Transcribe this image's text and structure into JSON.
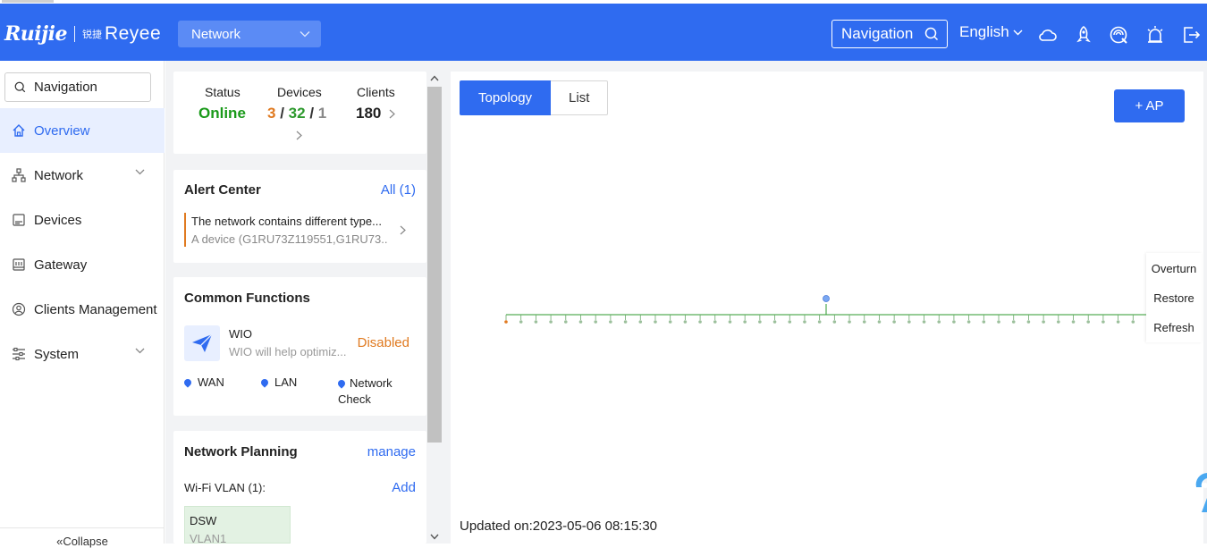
{
  "header": {
    "brand_left": "Ruijie",
    "brand_right_cn": "锐捷",
    "brand_right": "Reyee",
    "network_select": "Network",
    "navigation_label": "Navigation",
    "language": "English",
    "icons": [
      "cloud-icon",
      "rocket-icon",
      "network-check-icon",
      "alarm-icon",
      "logout-icon"
    ]
  },
  "sidebar": {
    "search_placeholder": "Navigation",
    "items": [
      {
        "label": "Overview",
        "icon": "home-icon",
        "active": true
      },
      {
        "label": "Network",
        "icon": "topology-icon",
        "has_chevron": true
      },
      {
        "label": "Devices",
        "icon": "devices-icon"
      },
      {
        "label": "Gateway",
        "icon": "gateway-icon"
      },
      {
        "label": "Clients Management",
        "icon": "user-icon"
      },
      {
        "label": "System",
        "icon": "settings-sliders-icon",
        "has_chevron": true
      }
    ],
    "collapse_label": "Collapse"
  },
  "status_card": {
    "status_label": "Status",
    "status_value": "Online",
    "devices_label": "Devices",
    "devices_online": "3",
    "devices_total": "32",
    "devices_offline": "1",
    "separator": "/",
    "clients_label": "Clients",
    "clients_value": "180"
  },
  "alert_center": {
    "title": "Alert Center",
    "all_link": "All (1)",
    "message": "The network contains different type...",
    "detail": "A device (G1RU73Z119551,G1RU73..."
  },
  "common_functions": {
    "title": "Common Functions",
    "wio_name": "WIO",
    "wio_desc": "WIO will help optimiz...",
    "wio_status": "Disabled",
    "links": [
      "WAN",
      "LAN",
      "Network Check"
    ]
  },
  "network_planning": {
    "title": "Network Planning",
    "manage_link": "manage",
    "wifi_vlan_label": "Wi-Fi VLAN (1):",
    "add_link": "Add",
    "vlan_ssid": "DSW",
    "vlan_id": "VLAN1"
  },
  "topology": {
    "tab_topology": "Topology",
    "tab_list": "List",
    "add_ap_label": "+ AP",
    "tools": [
      "Overturn",
      "Restore",
      "Refresh"
    ],
    "updated": "Updated on:2023-05-06 08:15:30",
    "node_count": 44
  },
  "colors": {
    "brand_blue": "#2f6bf0",
    "online_green": "#1a9a1a",
    "device_orange": "#e07a20",
    "device_green": "#2e9a2e",
    "device_gray": "#8a8a8a"
  }
}
